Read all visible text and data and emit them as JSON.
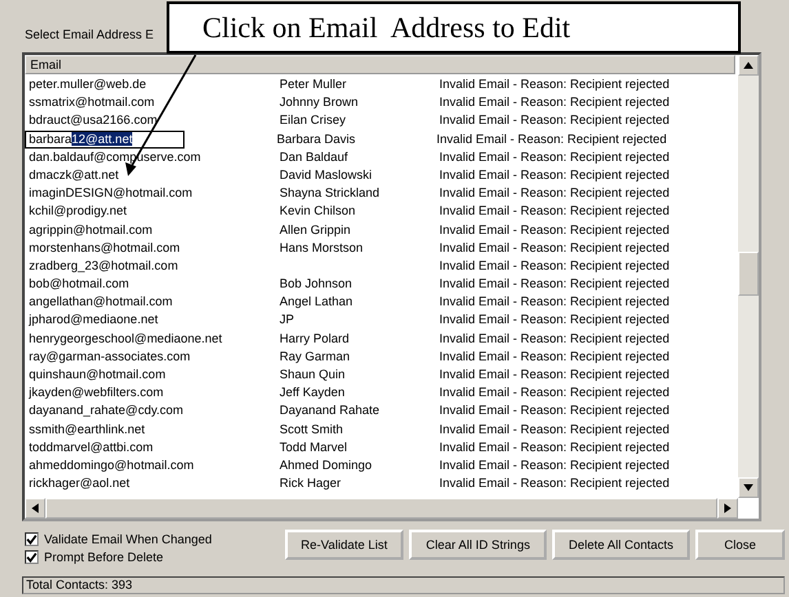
{
  "title": "Select Email Address E",
  "callout": {
    "text": "Click on Email  Address to Edit"
  },
  "table": {
    "columns": [
      "Email"
    ],
    "rows": [
      {
        "email": "peter.muller@web.de",
        "name": "Peter Muller",
        "reason": "Invalid Email - Reason: Recipient rejected",
        "editing": false
      },
      {
        "email": "ssmatrix@hotmail.com",
        "name": "Johnny Brown",
        "reason": "Invalid Email - Reason: Recipient rejected",
        "editing": false
      },
      {
        "email": "bdrauct@usa2166.com",
        "name": "Eilan Crisey",
        "reason": "Invalid Email - Reason: Recipient rejected",
        "editing": false
      },
      {
        "email": "barbara",
        "selection": "12@att.net",
        "name": "Barbara Davis",
        "reason": "Invalid Email - Reason: Recipient rejected",
        "editing": true
      },
      {
        "email": "dan.baldauf@compuserve.com",
        "name": "Dan Baldauf",
        "reason": "Invalid Email - Reason: Recipient rejected",
        "editing": false
      },
      {
        "email": "dmaczk@att.net",
        "name": "David Maslowski",
        "reason": "Invalid Email - Reason: Recipient rejected",
        "editing": false
      },
      {
        "email": "imaginDESIGN@hotmail.com",
        "name": "Shayna Strickland",
        "reason": "Invalid Email - Reason: Recipient rejected",
        "editing": false
      },
      {
        "email": "kchil@prodigy.net",
        "name": "Kevin Chilson",
        "reason": "Invalid Email - Reason: Recipient rejected",
        "editing": false
      },
      {
        "email": "agrippin@hotmail.com",
        "name": "Allen Grippin",
        "reason": "Invalid Email - Reason: Recipient rejected",
        "editing": false
      },
      {
        "email": "morstenhans@hotmail.com",
        "name": "Hans Morstson",
        "reason": "Invalid Email - Reason: Recipient rejected",
        "editing": false
      },
      {
        "email": "zradberg_23@hotmail.com",
        "reason": "Invalid Email - Reason: Recipient rejected",
        "editing": false
      },
      {
        "email": "bob@hotmail.com",
        "name": "Bob Johnson",
        "reason": "Invalid Email - Reason: Recipient rejected",
        "editing": false
      },
      {
        "email": "angellathan@hotmail.com",
        "name": "Angel Lathan",
        "reason": "Invalid Email - Reason: Recipient rejected",
        "editing": false
      },
      {
        "email": "jpharod@mediaone.net",
        "name": "JP",
        "reason": "Invalid Email - Reason: Recipient rejected",
        "editing": false
      },
      {
        "email": "henrygeorgeschool@mediaone.net",
        "name": "Harry Polard",
        "reason": "Invalid Email - Reason: Recipient rejected",
        "editing": false
      },
      {
        "email": "ray@garman-associates.com",
        "name": "Ray Garman",
        "reason": "Invalid Email - Reason: Recipient rejected",
        "editing": false
      },
      {
        "email": "quinshaun@hotmail.com",
        "name": "Shaun Quin",
        "reason": "Invalid Email - Reason: Recipient rejected",
        "editing": false
      },
      {
        "email": "jkayden@webfilters.com",
        "name": "Jeff Kayden",
        "reason": "Invalid Email - Reason: Recipient rejected",
        "editing": false
      },
      {
        "email": "dayanand_rahate@cdy.com",
        "name": "Dayanand Rahate",
        "reason": "Invalid Email - Reason: Recipient rejected",
        "editing": false
      },
      {
        "email": "ssmith@earthlink.net",
        "name": "Scott Smith",
        "reason": "Invalid Email - Reason: Recipient rejected",
        "editing": false
      },
      {
        "email": "toddmarvel@attbi.com",
        "name": "Todd Marvel",
        "reason": "Invalid Email - Reason: Recipient rejected",
        "editing": false
      },
      {
        "email": "ahmeddomingo@hotmail.com",
        "name": "Ahmed Domingo",
        "reason": "Invalid Email - Reason: Recipient rejected",
        "editing": false
      },
      {
        "email": "rickhager@aol.net",
        "name": "Rick Hager",
        "reason": "Invalid Email - Reason: Recipient rejected",
        "editing": false
      }
    ]
  },
  "options": [
    {
      "label": "Validate Email When Changed",
      "checked": true
    },
    {
      "label": "Prompt Before Delete",
      "checked": true
    }
  ],
  "buttons": [
    "Re-Validate List",
    "Clear All ID Strings",
    "Delete All Contacts",
    "Close"
  ],
  "status_bar": "Total Contacts: 393"
}
